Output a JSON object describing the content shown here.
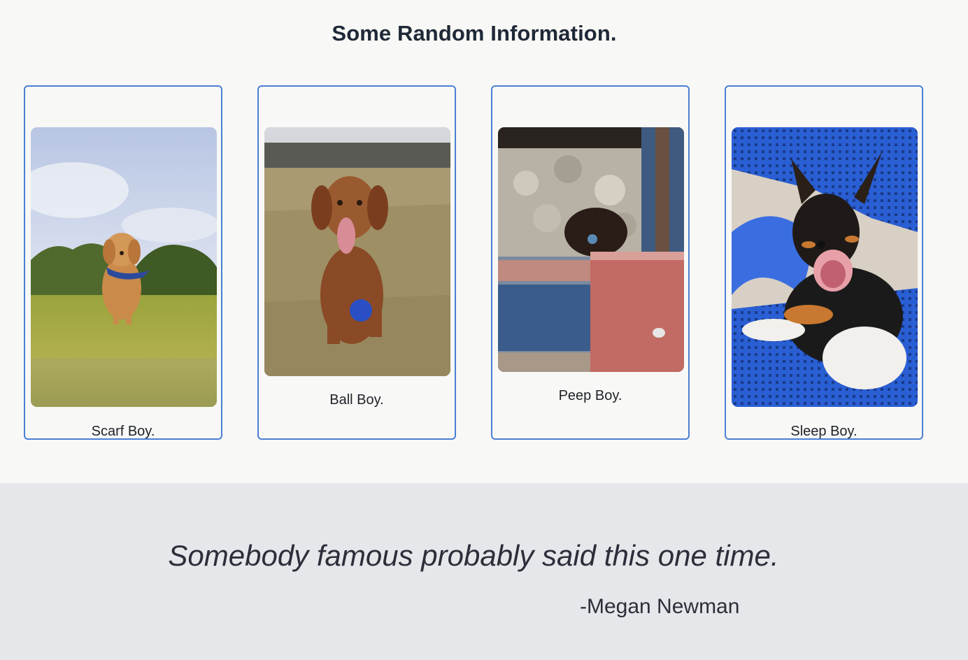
{
  "info": {
    "title": "Some Random Information."
  },
  "cards": [
    {
      "caption": "Scarf Boy.",
      "image": "golden-retriever-puppy-with-blue-scarf-photo"
    },
    {
      "caption": "Ball Boy.",
      "image": "brown-dog-with-blue-ball-photo"
    },
    {
      "caption": "Peep Boy.",
      "image": "puppy-peeking-from-wooden-box-photo"
    },
    {
      "caption": "Sleep Boy.",
      "image": "yawning-puppy-on-blue-chair-photo"
    }
  ],
  "quote": {
    "text": "Somebody famous probably said this one time.",
    "author": "-Megan Newman"
  },
  "colors": {
    "card_border": "#4a7fd6",
    "page_background": "#f8f8f6",
    "quote_background": "#e6e7ea"
  }
}
